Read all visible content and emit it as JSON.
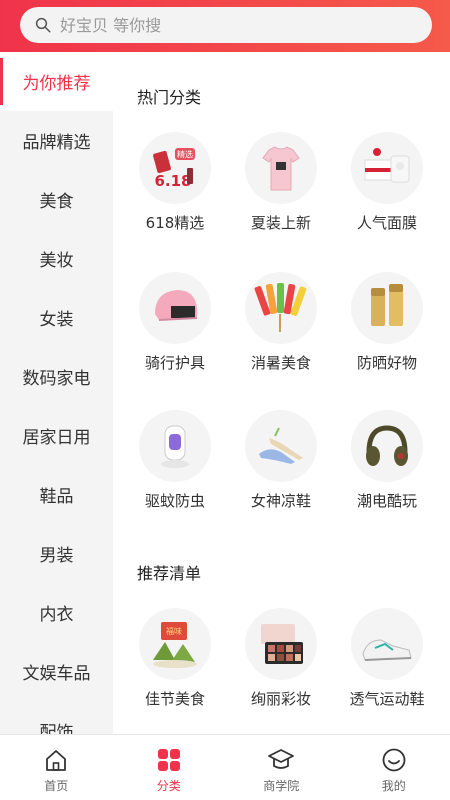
{
  "search": {
    "placeholder": "好宝贝 等你搜"
  },
  "sidebar": {
    "items": [
      {
        "label": "为你推荐",
        "active": true
      },
      {
        "label": "品牌精选"
      },
      {
        "label": "美食"
      },
      {
        "label": "美妆"
      },
      {
        "label": "女装"
      },
      {
        "label": "数码家电"
      },
      {
        "label": "居家日用"
      },
      {
        "label": "鞋品"
      },
      {
        "label": "男装"
      },
      {
        "label": "内衣"
      },
      {
        "label": "文娱车品"
      },
      {
        "label": "配饰"
      }
    ]
  },
  "main": {
    "hot_title": "热门分类",
    "hot_items": [
      {
        "label": "618精选",
        "icon": "cosmetics-618-icon",
        "badge": "精选",
        "badge_sub": "6.18"
      },
      {
        "label": "夏装上新",
        "icon": "tshirt-icon"
      },
      {
        "label": "人气面膜",
        "icon": "face-mask-icon"
      },
      {
        "label": "骑行护具",
        "icon": "helmet-icon"
      },
      {
        "label": "消暑美食",
        "icon": "ice-pops-icon"
      },
      {
        "label": "防晒好物",
        "icon": "sunscreen-icon"
      },
      {
        "label": "驱蚊防虫",
        "icon": "mosquito-lamp-icon"
      },
      {
        "label": "女神凉鞋",
        "icon": "sandals-icon"
      },
      {
        "label": "潮电酷玩",
        "icon": "headphones-icon"
      }
    ],
    "rec_title": "推荐清单",
    "rec_items": [
      {
        "label": "佳节美食",
        "icon": "zongzi-icon",
        "badge": "福味"
      },
      {
        "label": "绚丽彩妆",
        "icon": "eyeshadow-palette-icon"
      },
      {
        "label": "透气运动鞋",
        "icon": "sneakers-icon"
      }
    ]
  },
  "tabbar": {
    "items": [
      {
        "label": "首页",
        "icon": "home-icon"
      },
      {
        "label": "分类",
        "icon": "category-icon",
        "active": true
      },
      {
        "label": "商学院",
        "icon": "graduation-cap-icon"
      },
      {
        "label": "我的",
        "icon": "smiley-icon"
      }
    ]
  },
  "colors": {
    "accent": "#f0334b",
    "sidebar_bg": "#f4f4f4"
  }
}
